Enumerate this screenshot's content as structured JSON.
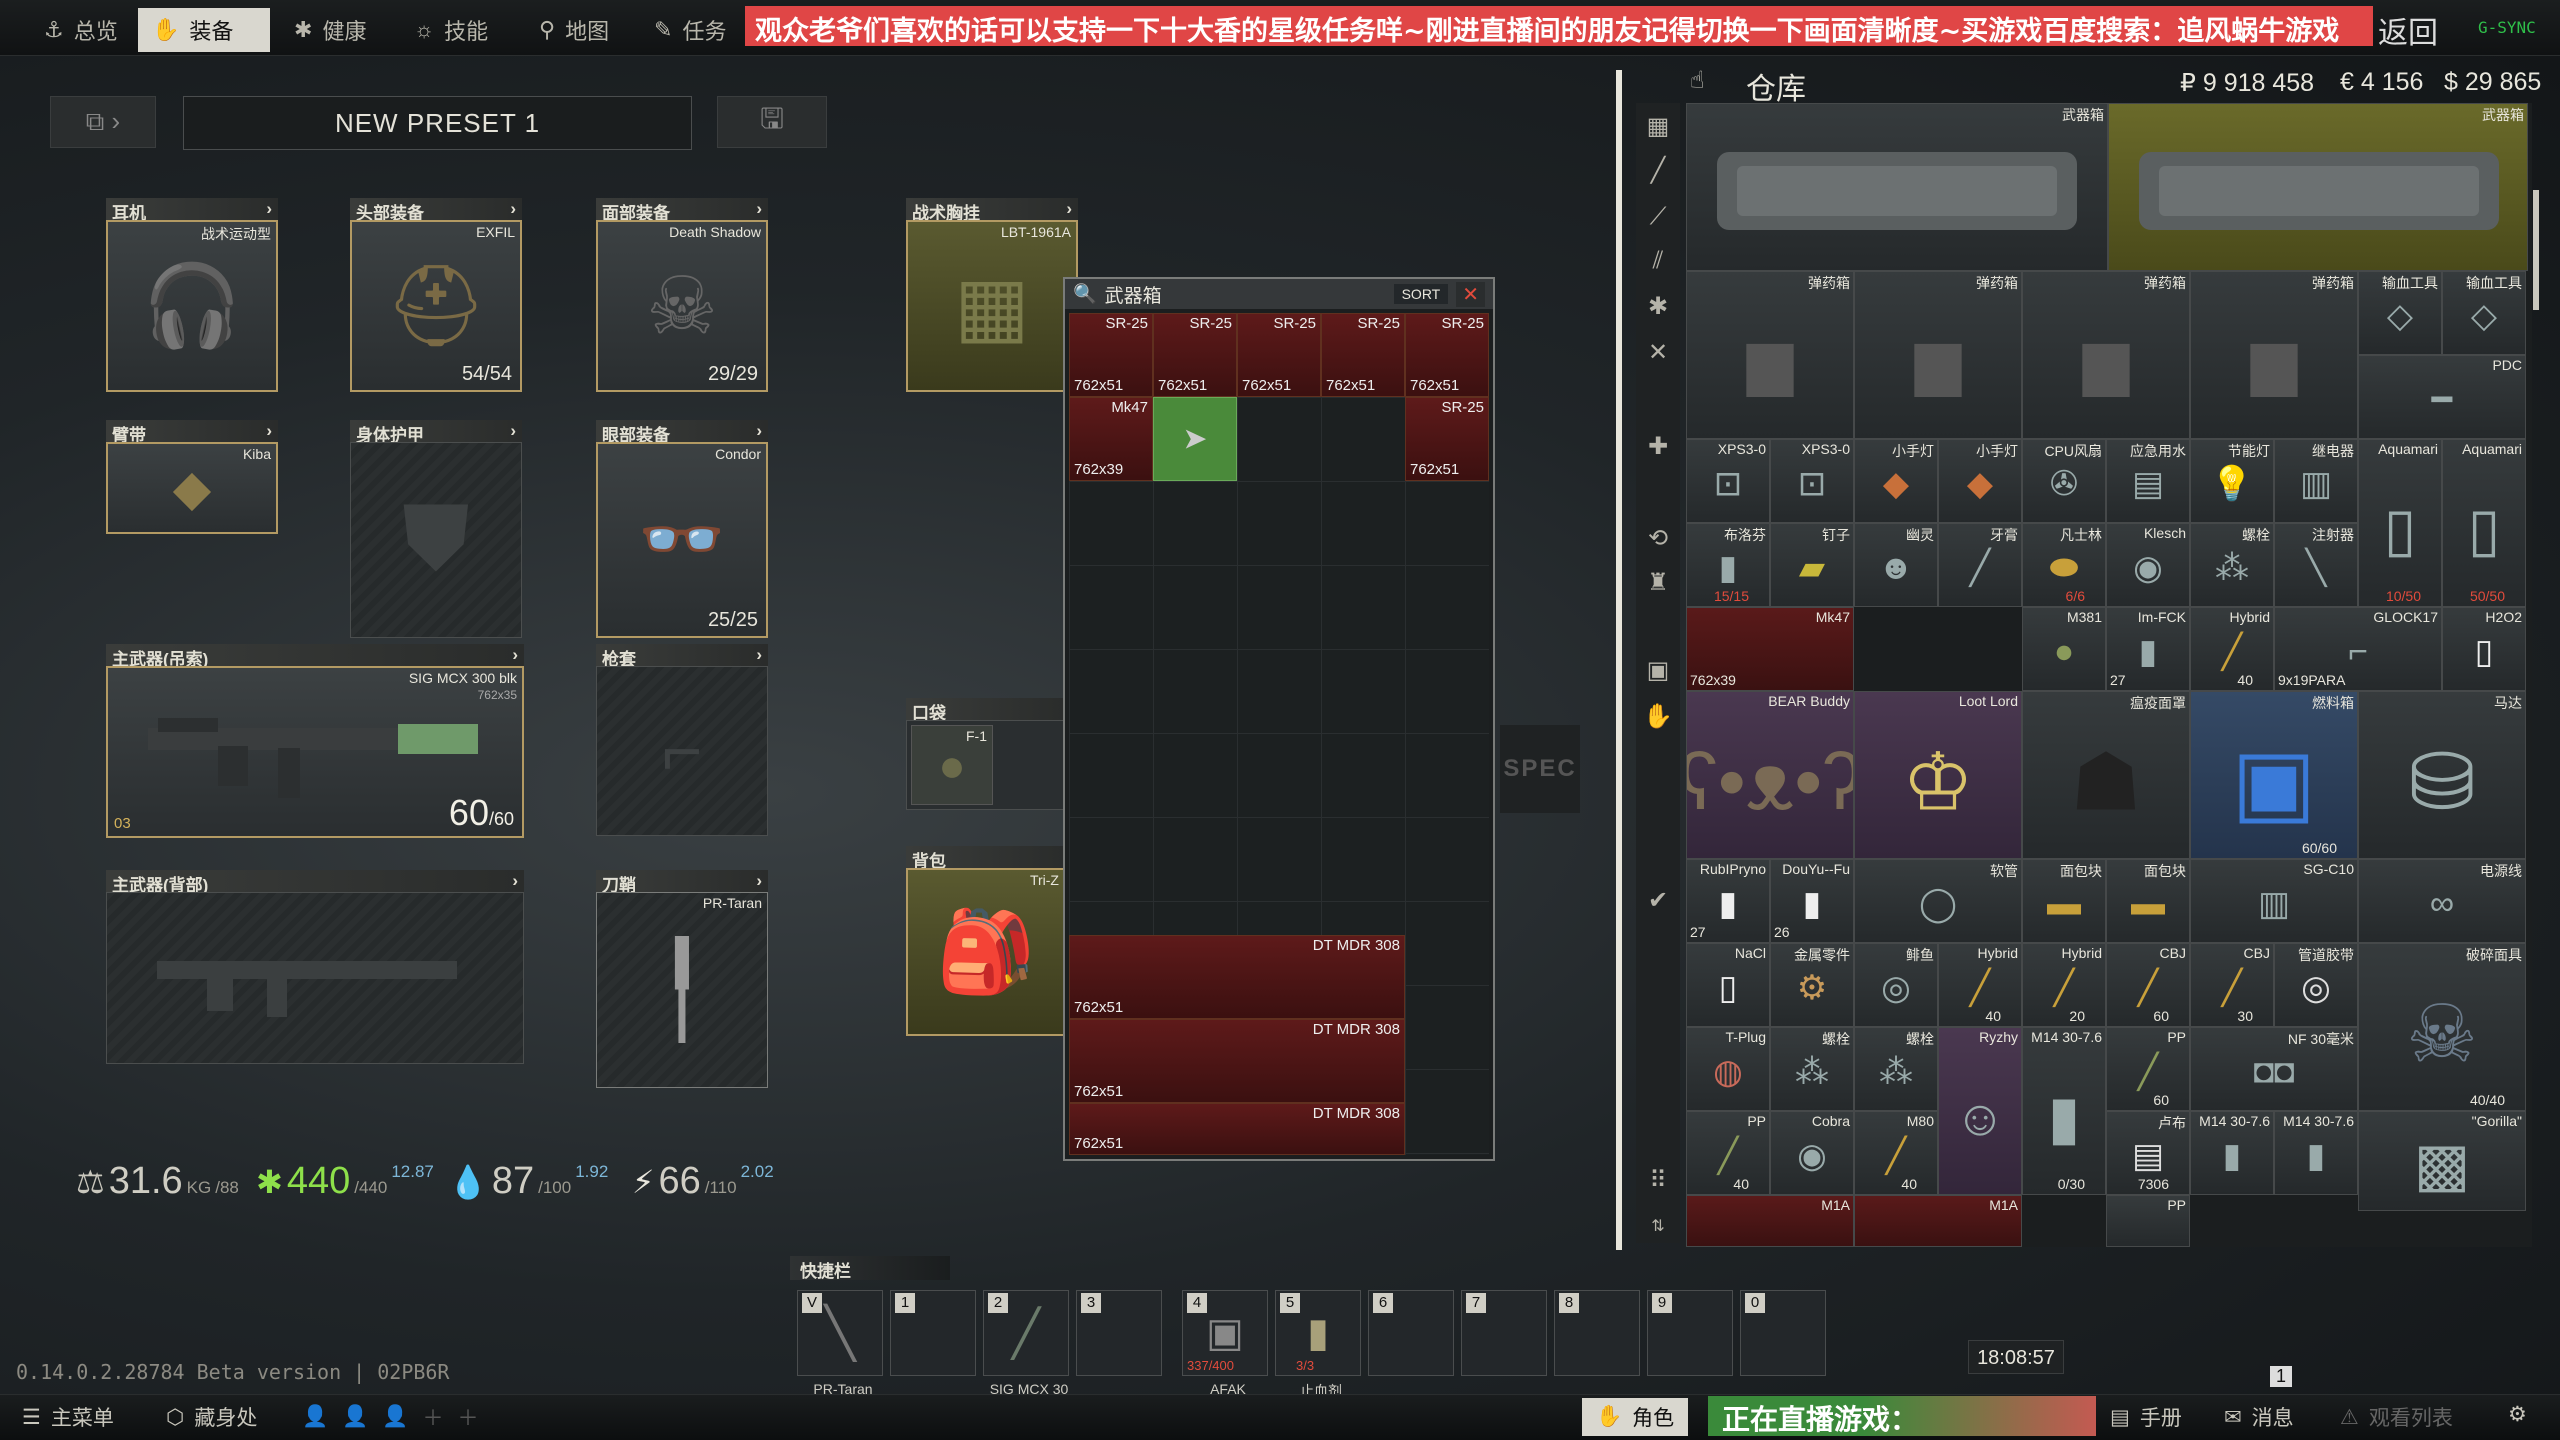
{
  "topnav": {
    "tabs": [
      {
        "label": "总览",
        "icon": "anchor-icon"
      },
      {
        "label": "装备",
        "icon": "hand-icon",
        "active": true
      },
      {
        "label": "健康",
        "icon": "health-icon"
      },
      {
        "label": "技能",
        "icon": "skills-icon"
      },
      {
        "label": "地图",
        "icon": "map-pin-icon"
      },
      {
        "label": "任务",
        "icon": "task-icon"
      }
    ],
    "banner": "观众老爷们喜欢的话可以支持一下十大香的星级任务咩~刚进直播间的朋友记得切换一下画面清晰度~买游戏百度搜索：追风蜗牛游戏",
    "back_label": "返回",
    "gsync": "G-SYNC"
  },
  "preset": {
    "name": "NEW PRESET 1"
  },
  "slots": {
    "earpiece": {
      "header": "耳机",
      "item": "战术运动型"
    },
    "headwear": {
      "header": "头部装备",
      "item": "EXFIL",
      "durability": "54/54"
    },
    "facecover": {
      "header": "面部装备",
      "item": "Death Shadow",
      "durability": "29/29"
    },
    "rig": {
      "header": "战术胸挂",
      "item": "LBT-1961A"
    },
    "armband": {
      "header": "臂带",
      "item": "Kiba"
    },
    "armor": {
      "header": "身体护甲"
    },
    "eyewear": {
      "header": "眼部装备",
      "item": "Condor",
      "durability": "25/25"
    },
    "primary1": {
      "header": "主武器(吊索)",
      "item": "SIG MCX 300 blk",
      "caliber": "762x35",
      "ammo": "60",
      "ammo_max": "/60",
      "level": "03"
    },
    "holster": {
      "header": "枪套"
    },
    "primary2": {
      "header": "主武器(背部)"
    },
    "scabbard": {
      "header": "刀鞘",
      "item": "PR-Taran"
    },
    "pockets": {
      "header": "口袋",
      "item": "F-1"
    },
    "backpack": {
      "header": "背包",
      "item": "Tri-Z"
    }
  },
  "stats": {
    "weight": "31.6",
    "weight_unit": "KG",
    "weight_max": "/88",
    "health": "440",
    "health_max": "/440",
    "health_up": "12.87",
    "hydration": "87",
    "hydration_max": "/100",
    "hydration_up": "1.92",
    "energy": "66",
    "energy_max": "/110",
    "energy_up": "2.02"
  },
  "weapon_case": {
    "title": "武器箱",
    "sort": "SORT",
    "items": [
      {
        "name": "SR-25",
        "cal": "762x51"
      },
      {
        "name": "SR-25",
        "cal": "762x51"
      },
      {
        "name": "SR-25",
        "cal": "762x51"
      },
      {
        "name": "SR-25",
        "cal": "762x51"
      },
      {
        "name": "SR-25",
        "cal": "762x51"
      },
      {
        "name": "Mk47",
        "cal": "762x39"
      },
      {
        "name": "SR-25",
        "cal": "762x51"
      },
      {
        "name": "DT MDR 308",
        "cal": "762x51"
      },
      {
        "name": "DT MDR 308",
        "cal": "762x51"
      },
      {
        "name": "DT MDR 308",
        "cal": "762x51"
      }
    ]
  },
  "stash": {
    "title": "仓库",
    "money": {
      "rub": "₽ 9 918 458",
      "eur": "€ 4 156",
      "usd": "$ 29 865"
    },
    "items": [
      {
        "n": "武器箱"
      },
      {
        "n": "武器箱"
      },
      {
        "n": "弹药箱"
      },
      {
        "n": "弹药箱"
      },
      {
        "n": "弹药箱"
      },
      {
        "n": "弹药箱"
      },
      {
        "n": "输血工具"
      },
      {
        "n": "输血工具"
      },
      {
        "n": "PDC"
      },
      {
        "n": "XPS3-0"
      },
      {
        "n": "XPS3-0"
      },
      {
        "n": "小手灯"
      },
      {
        "n": "小手灯"
      },
      {
        "n": "CPU风扇"
      },
      {
        "n": "应急用水"
      },
      {
        "n": "节能灯"
      },
      {
        "n": "继电器"
      },
      {
        "n": "Aquamari",
        "c": "10/50"
      },
      {
        "n": "Aquamari",
        "c": "50/50"
      },
      {
        "n": "布洛芬",
        "c": "15/15"
      },
      {
        "n": "钉子"
      },
      {
        "n": "幽灵"
      },
      {
        "n": "牙膏"
      },
      {
        "n": "凡士林",
        "c": "6/6"
      },
      {
        "n": "Klesch"
      },
      {
        "n": "螺栓"
      },
      {
        "n": "注射器"
      },
      {
        "n": "Mk47",
        "cl": "762x39"
      },
      {
        "n": "M381"
      },
      {
        "n": "Im-FCK",
        "c": "27"
      },
      {
        "n": "Hybrid",
        "c": "40"
      },
      {
        "n": "GLOCK17",
        "cl": "9x19PARA"
      },
      {
        "n": "H2O2"
      },
      {
        "n": "BEAR Buddy"
      },
      {
        "n": "Loot Lord"
      },
      {
        "n": "瘟疫面罩"
      },
      {
        "n": "燃料箱",
        "c": "60/60"
      },
      {
        "n": "马达"
      },
      {
        "n": "RubIPryno",
        "c": "27"
      },
      {
        "n": "DouYu--Fu",
        "c": "26"
      },
      {
        "n": "软管"
      },
      {
        "n": "面包块"
      },
      {
        "n": "面包块"
      },
      {
        "n": "SG-C10"
      },
      {
        "n": "电源线"
      },
      {
        "n": "NaCl"
      },
      {
        "n": "金属零件"
      },
      {
        "n": "鲱鱼"
      },
      {
        "n": "Hybrid",
        "c": "40"
      },
      {
        "n": "Hybrid",
        "c": "20"
      },
      {
        "n": "CBJ",
        "c": "60"
      },
      {
        "n": "CBJ",
        "c": "30"
      },
      {
        "n": "管道胶带"
      },
      {
        "n": "破碎面具",
        "c": "40/40"
      },
      {
        "n": "T-Plug"
      },
      {
        "n": "螺栓"
      },
      {
        "n": "螺栓"
      },
      {
        "n": "Ryzhy"
      },
      {
        "n": "M14 30-7.6",
        "c": "0/30"
      },
      {
        "n": "PP",
        "c": "60"
      },
      {
        "n": "NF 30毫米"
      },
      {
        "n": "PP",
        "c": "40"
      },
      {
        "n": "Cobra"
      },
      {
        "n": "M80",
        "c": "40"
      },
      {
        "n": "卢布",
        "c": "7306"
      },
      {
        "n": "M14 30-7.6"
      },
      {
        "n": "M14 30-7.6"
      },
      {
        "n": "\"Gorilla\""
      },
      {
        "n": "M1A"
      },
      {
        "n": "M1A"
      },
      {
        "n": "PP"
      }
    ]
  },
  "quickbar": {
    "title": "快捷栏",
    "slots": [
      {
        "key": "V",
        "label": "PR-Taran"
      },
      {
        "key": "1",
        "label": ""
      },
      {
        "key": "2",
        "label": "SIG MCX 30"
      },
      {
        "key": "3",
        "label": ""
      },
      {
        "key": "4",
        "label": "AFAK",
        "count": "337/400"
      },
      {
        "key": "5",
        "label": "止血剂",
        "count": "3/3"
      },
      {
        "key": "6",
        "label": ""
      },
      {
        "key": "7",
        "label": ""
      },
      {
        "key": "8",
        "label": ""
      },
      {
        "key": "9",
        "label": ""
      },
      {
        "key": "0",
        "label": ""
      }
    ]
  },
  "version": "0.14.0.2.28784 Beta version | 02PB6R",
  "clock": "18:08:57",
  "bottom": {
    "menu": "主菜单",
    "hideout": "藏身处",
    "character": "角色",
    "live": "正在直播游戏：",
    "handbook": "手册",
    "messages": "消息",
    "watchlist": "观看列表",
    "badge": "1"
  }
}
